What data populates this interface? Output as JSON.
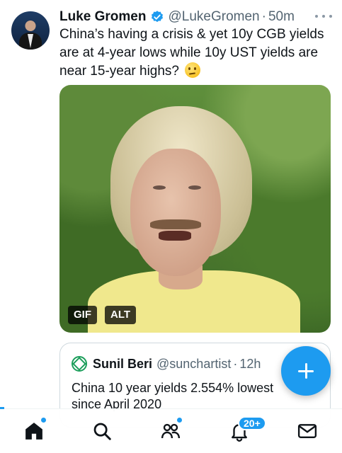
{
  "tweet": {
    "author_name": "Luke Gromen",
    "handle": "@LukeGromen",
    "separator": "·",
    "time": "50m",
    "text": "China’s having a crisis & yet 10y CGB yields are at 4-year lows while 10y UST yields are near 15-year highs?",
    "emoji": "thinking-face-emoji",
    "media": {
      "gif_label": "GIF",
      "alt_label": "ALT"
    }
  },
  "quote": {
    "author_name": "Sunil Beri",
    "handle": "@sunchartist",
    "separator": "·",
    "time": "12h",
    "text": "China 10 year yields 2.554% lowest since April 2020"
  },
  "nav": {
    "items": [
      "home-icon",
      "search-icon",
      "communities-icon",
      "notifications-icon",
      "messages-icon"
    ],
    "notifications_badge": "20+"
  },
  "colors": {
    "accent": "#1d9bf0",
    "text": "#0f1419",
    "secondary": "#536471"
  }
}
